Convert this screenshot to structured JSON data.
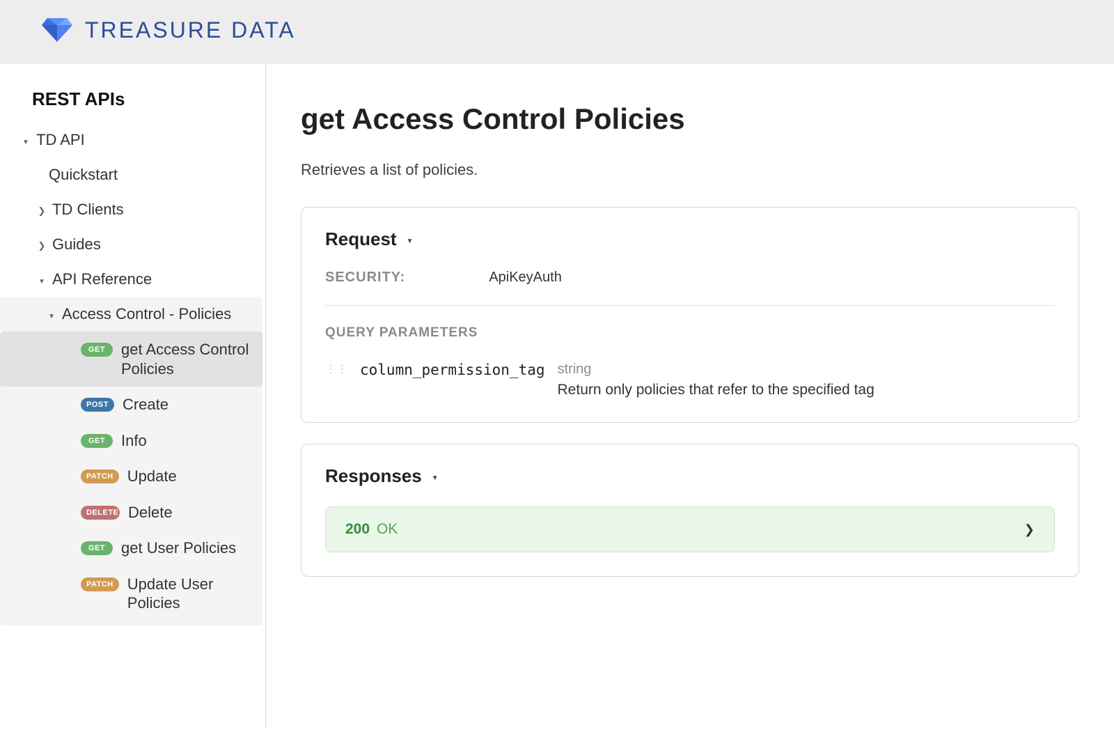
{
  "brand": "TREASURE DATA",
  "sidebar": {
    "title": "REST APIs",
    "root": {
      "label": "TD API"
    },
    "items": [
      {
        "label": "Quickstart"
      },
      {
        "label": "TD Clients"
      },
      {
        "label": "Guides"
      },
      {
        "label": "API Reference"
      }
    ],
    "section": {
      "label": "Access Control - Policies"
    },
    "endpoints": [
      {
        "method": "GET",
        "label": "get Access Control Policies"
      },
      {
        "method": "POST",
        "label": "Create"
      },
      {
        "method": "GET",
        "label": "Info"
      },
      {
        "method": "PATCH",
        "label": "Update"
      },
      {
        "method": "DELETE",
        "label": "Delete"
      },
      {
        "method": "GET",
        "label": "get User Policies"
      },
      {
        "method": "PATCH",
        "label": "Update User Policies"
      }
    ]
  },
  "page": {
    "title": "get Access Control Policies",
    "description": "Retrieves a list of policies."
  },
  "request": {
    "heading": "Request",
    "security_label": "SECURITY:",
    "security_value": "ApiKeyAuth",
    "query_params_label": "QUERY PARAMETERS",
    "params": [
      {
        "name": "column_permission_tag",
        "type": "string",
        "description": "Return only policies that refer to the specified tag"
      }
    ]
  },
  "responses": {
    "heading": "Responses",
    "items": [
      {
        "code": "200",
        "text": "OK"
      }
    ]
  }
}
